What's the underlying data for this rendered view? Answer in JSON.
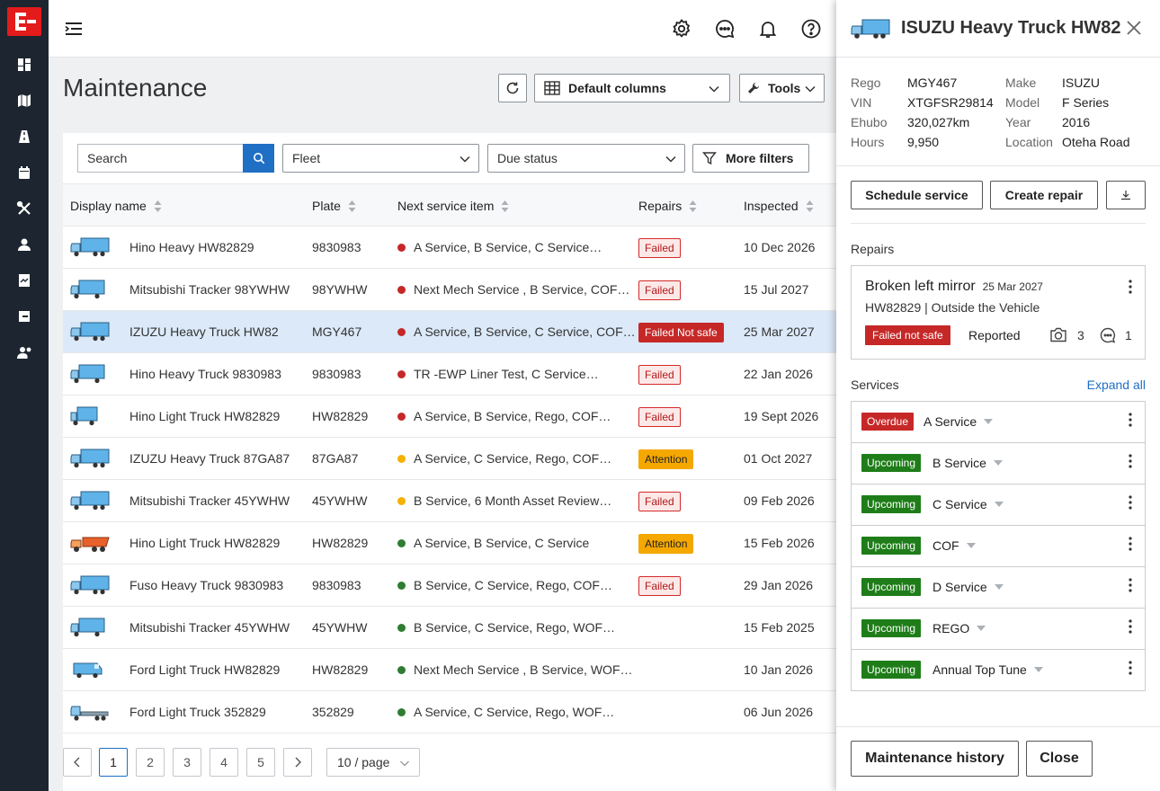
{
  "app": {
    "logo": "E-brand-logo"
  },
  "rail": [
    "dashboard-icon",
    "map-icon",
    "road-icon",
    "calendar-icon",
    "tools-icon",
    "user-icon",
    "report-icon",
    "card-icon",
    "team-settings-icon"
  ],
  "header": {
    "icons": [
      "gear-icon",
      "chat-icon",
      "bell-icon",
      "help-icon"
    ]
  },
  "page": {
    "title": "Maintenance",
    "columns_button": "Default columns",
    "tools_button": "Tools"
  },
  "filters": {
    "search_placeholder": "Search",
    "fleet": "Fleet",
    "due_status": "Due status",
    "more_filters": "More filters"
  },
  "table": {
    "headers": [
      "Display name",
      "Plate",
      "Next service item",
      "Repairs",
      "Inspected"
    ],
    "rows": [
      {
        "icon": "truck-large",
        "name": "Hino Heavy HW82829",
        "plate": "9830983",
        "status": "red",
        "service": "A Service, B Service, C Service…",
        "repair": "Failed",
        "repair_type": "failed",
        "inspected": "10 Dec 2026",
        "selected": false
      },
      {
        "icon": "truck-medium",
        "name": "Mitsubishi Tracker 98YWHW",
        "plate": "98YWHW",
        "status": "red",
        "service": "Next Mech Service , B Service, COF…",
        "repair": "Failed",
        "repair_type": "failed",
        "inspected": "15 Jul 2027",
        "selected": false
      },
      {
        "icon": "truck-large",
        "name": "IZUZU Heavy Truck HW82",
        "plate": "MGY467",
        "status": "red",
        "service": "A Service, B Service, C Service, COF…",
        "repair": "Failed Not safe",
        "repair_type": "notsafe",
        "inspected": "25 Mar 2027",
        "selected": true
      },
      {
        "icon": "truck-medium",
        "name": "Hino Heavy Truck 9830983",
        "plate": "9830983",
        "status": "red",
        "service": "TR -EWP Liner Test, C Service…",
        "repair": "Failed",
        "repair_type": "failed",
        "inspected": "22 Jan 2026",
        "selected": false
      },
      {
        "icon": "truck-small",
        "name": "Hino Light Truck HW82829",
        "plate": "HW82829",
        "status": "red",
        "service": "A Service, B Service, Rego, COF…",
        "repair": "Failed",
        "repair_type": "failed",
        "inspected": "19 Sept 2026",
        "selected": false
      },
      {
        "icon": "truck-large",
        "name": "IZUZU Heavy Truck 87GA87",
        "plate": "87GA87",
        "status": "amber",
        "service": "A Service, C Service, Rego, COF…",
        "repair": "Attention",
        "repair_type": "attention",
        "inspected": "01 Oct 2027",
        "selected": false
      },
      {
        "icon": "truck-large",
        "name": "Mitsubishi Tracker 45YWHW",
        "plate": "45YWHW",
        "status": "amber",
        "service": "B Service, 6 Month Asset Review…",
        "repair": "Failed",
        "repair_type": "failed",
        "inspected": "09 Feb 2026",
        "selected": false
      },
      {
        "icon": "dump-truck",
        "name": "Hino Light Truck HW82829",
        "plate": "HW82829",
        "status": "green",
        "service": "A Service, B Service, C Service",
        "repair": "Attention",
        "repair_type": "attention",
        "inspected": "15 Feb 2026",
        "selected": false
      },
      {
        "icon": "truck-large",
        "name": "Fuso Heavy Truck 9830983",
        "plate": "9830983",
        "status": "green",
        "service": "B Service, C Service, Rego, COF…",
        "repair": "Failed",
        "repair_type": "failed",
        "inspected": "29 Jan 2026",
        "selected": false
      },
      {
        "icon": "truck-medium",
        "name": "Mitsubishi Tracker 45YWHW",
        "plate": "45YWHW",
        "status": "green",
        "service": "B Service, C Service, Rego, WOF…",
        "repair": "",
        "repair_type": "none",
        "inspected": "15 Feb 2025",
        "selected": false
      },
      {
        "icon": "van",
        "name": "Ford Light Truck HW82829",
        "plate": "HW82829",
        "status": "green",
        "service": "Next Mech Service , B Service, WOF…",
        "repair": "",
        "repair_type": "none",
        "inspected": "10 Jan 2026",
        "selected": false
      },
      {
        "icon": "flatbed",
        "name": "Ford Light Truck 352829",
        "plate": "352829",
        "status": "green",
        "service": "A Service, C Service, Rego, WOF…",
        "repair": "",
        "repair_type": "none",
        "inspected": "06 Jun 2026",
        "selected": false
      }
    ]
  },
  "pagination": {
    "pages": [
      "1",
      "2",
      "3",
      "4",
      "5"
    ],
    "active": "1",
    "page_size": "10 / page"
  },
  "colors": {
    "red": "#c62828",
    "amber": "#f5b000",
    "green": "#2e7d32",
    "primary": "#1f6fc5",
    "upcoming": "#1e7d18",
    "overdue": "#c62828"
  },
  "drawer": {
    "title": "ISUZU Heavy Truck HW82",
    "details_left": [
      {
        "k": "Rego",
        "v": "MGY467"
      },
      {
        "k": "VIN",
        "v": "XTGFSR29814"
      },
      {
        "k": "Ehubo",
        "v": "320,027km"
      },
      {
        "k": "Hours",
        "v": "9,950"
      }
    ],
    "details_right": [
      {
        "k": "Make",
        "v": "ISUZU"
      },
      {
        "k": "Model",
        "v": "F Series"
      },
      {
        "k": "Year",
        "v": "2016"
      },
      {
        "k": "Location",
        "v": "Oteha Road"
      }
    ],
    "schedule_button": "Schedule service",
    "create_repair_button": "Create repair",
    "repairs_title": "Repairs",
    "repair": {
      "title": "Broken left mirror",
      "date": "25 Mar 2027",
      "subtitle": "HW82829 | Outside the Vehicle",
      "tag": "Failed not safe",
      "status": "Reported",
      "photos": "3",
      "comments": "1"
    },
    "services_title": "Services",
    "expand_all": "Expand all",
    "services": [
      {
        "tag": "Overdue",
        "name": "A Service",
        "type": "overdue"
      },
      {
        "tag": "Upcoming",
        "name": "B Service",
        "type": "upcoming"
      },
      {
        "tag": "Upcoming",
        "name": "C Service",
        "type": "upcoming"
      },
      {
        "tag": "Upcoming",
        "name": "COF",
        "type": "upcoming"
      },
      {
        "tag": "Upcoming",
        "name": "D Service",
        "type": "upcoming"
      },
      {
        "tag": "Upcoming",
        "name": "REGO",
        "type": "upcoming"
      },
      {
        "tag": "Upcoming",
        "name": "Annual Top Tune",
        "type": "upcoming"
      }
    ],
    "history_button": "Maintenance history",
    "close_button": "Close"
  }
}
